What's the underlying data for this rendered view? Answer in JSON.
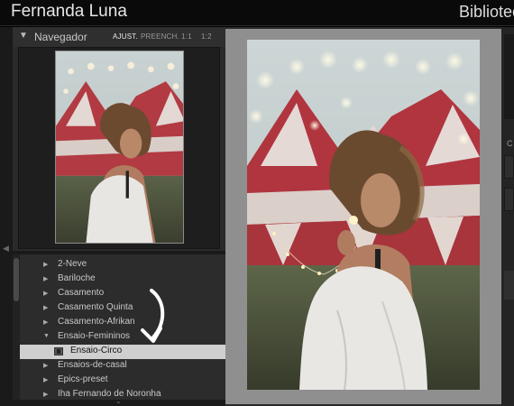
{
  "topbar": {
    "identity_plate": "Fernanda Luna",
    "module": "Biblioteca"
  },
  "navigator": {
    "title": "Navegador",
    "zoom_options": [
      {
        "label": "AJUST.",
        "active": true
      },
      {
        "label": "PREENCH.",
        "active": false
      },
      {
        "label": "1:1",
        "active": false
      },
      {
        "label": "1:2",
        "active": false
      }
    ]
  },
  "folders": [
    {
      "label": "2-Neve",
      "selected": false,
      "type": "folder"
    },
    {
      "label": "Bariloche",
      "selected": false,
      "type": "folder"
    },
    {
      "label": "Casamento",
      "selected": false,
      "type": "folder"
    },
    {
      "label": "Casamento Quinta",
      "selected": false,
      "type": "folder"
    },
    {
      "label": "Casamento-Afrikan",
      "selected": false,
      "type": "folder"
    },
    {
      "label": "Ensaio-Femininos",
      "selected": false,
      "type": "folder"
    },
    {
      "label": "Ensaio-Circo",
      "selected": true,
      "type": "collection"
    },
    {
      "label": "Ensaios-de-casal",
      "selected": false,
      "type": "folder"
    },
    {
      "label": "Epics-preset",
      "selected": false,
      "type": "folder"
    },
    {
      "label": "Iha Fernando de Noronha",
      "selected": false,
      "type": "folder"
    }
  ],
  "right_panel": {
    "partial_letter": "C"
  },
  "colors": {
    "panel": "#2a2a2a",
    "selection": "#cfcfcf",
    "canvas": "#8f8f8f"
  },
  "icons": {
    "disclosure": "triangle-right",
    "collection": "collection-icon",
    "annotation": "curved-arrow-icon"
  }
}
